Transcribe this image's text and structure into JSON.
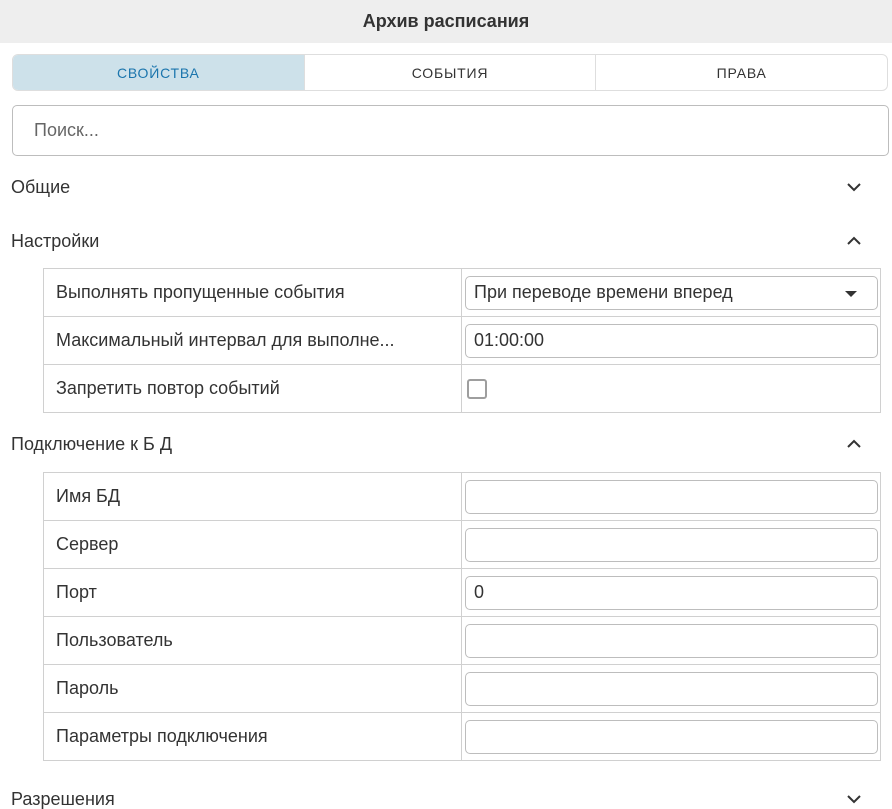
{
  "window": {
    "title": "Архив расписания"
  },
  "tabs": [
    {
      "label": "СВОЙСТВА",
      "active": true
    },
    {
      "label": "СОБЫТИЯ",
      "active": false
    },
    {
      "label": "ПРАВА",
      "active": false
    }
  ],
  "search": {
    "placeholder": "Поиск...",
    "value": ""
  },
  "sections": {
    "general": {
      "title": "Общие",
      "expanded": false
    },
    "settings": {
      "title": "Настройки",
      "expanded": true,
      "rows": {
        "missed_events": {
          "label": "Выполнять пропущенные события",
          "value": "При переводе времени вперед"
        },
        "max_interval": {
          "label": "Максимальный интервал для выполне...",
          "value": "01:00:00"
        },
        "forbid_repeat": {
          "label": "Запретить повтор событий",
          "checked": false
        }
      }
    },
    "db_connection": {
      "title": "Подключение к Б Д",
      "expanded": true,
      "rows": {
        "db_name": {
          "label": "Имя БД",
          "value": ""
        },
        "server": {
          "label": "Сервер",
          "value": ""
        },
        "port": {
          "label": "Порт",
          "value": "0"
        },
        "user": {
          "label": "Пользователь",
          "value": ""
        },
        "password": {
          "label": "Пароль",
          "value": ""
        },
        "conn_params": {
          "label": "Параметры подключения",
          "value": ""
        }
      }
    },
    "permissions": {
      "title": "Разрешения",
      "expanded": false
    }
  },
  "icons": {
    "collapsed": "chevron-down-icon",
    "expanded": "chevron-up-icon",
    "dropdown": "caret-down-icon"
  },
  "colors": {
    "title_bg": "#eeeeee",
    "active_tab_bg": "#cde1ea",
    "active_tab_text": "#1b75ad",
    "border": "#d0d0d0",
    "text": "#333333"
  }
}
